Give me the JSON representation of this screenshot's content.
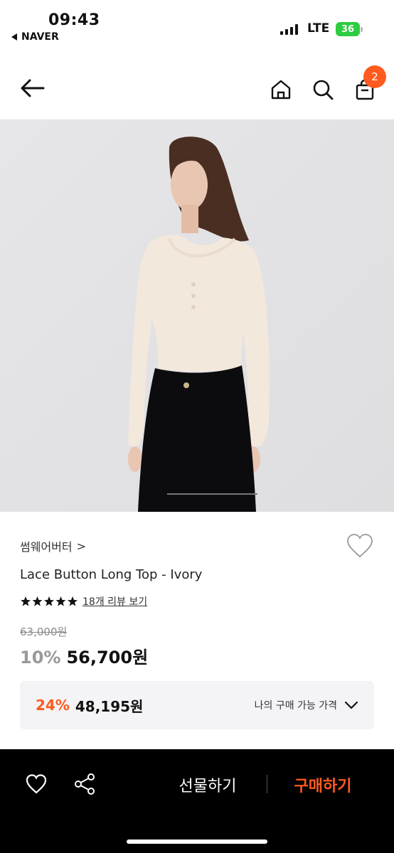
{
  "status_bar": {
    "time": "09:43",
    "back_app": "NAVER",
    "network": "LTE",
    "battery": "36"
  },
  "header": {
    "cart_count": "2",
    "icons": [
      "back-arrow-icon",
      "home-icon",
      "search-icon",
      "cart-icon"
    ]
  },
  "product": {
    "brand": "썸웨어버터",
    "brand_chevron": ">",
    "title": "Lace Button Long Top - Ivory",
    "rating_stars": 5,
    "review_link": "18개 리뷰 보기",
    "original_price": "63,000원",
    "discount": "10%",
    "price": "56,700원"
  },
  "benefit": {
    "discount": "24%",
    "price": "48,195원",
    "label": "나의 구매 가능 가격"
  },
  "bottom_bar": {
    "gift_label": "선물하기",
    "buy_label": "구매하기"
  },
  "colors": {
    "accent": "#ff5a1f",
    "battery": "#2ecc40",
    "hero_bg": "#e4e4e6"
  }
}
